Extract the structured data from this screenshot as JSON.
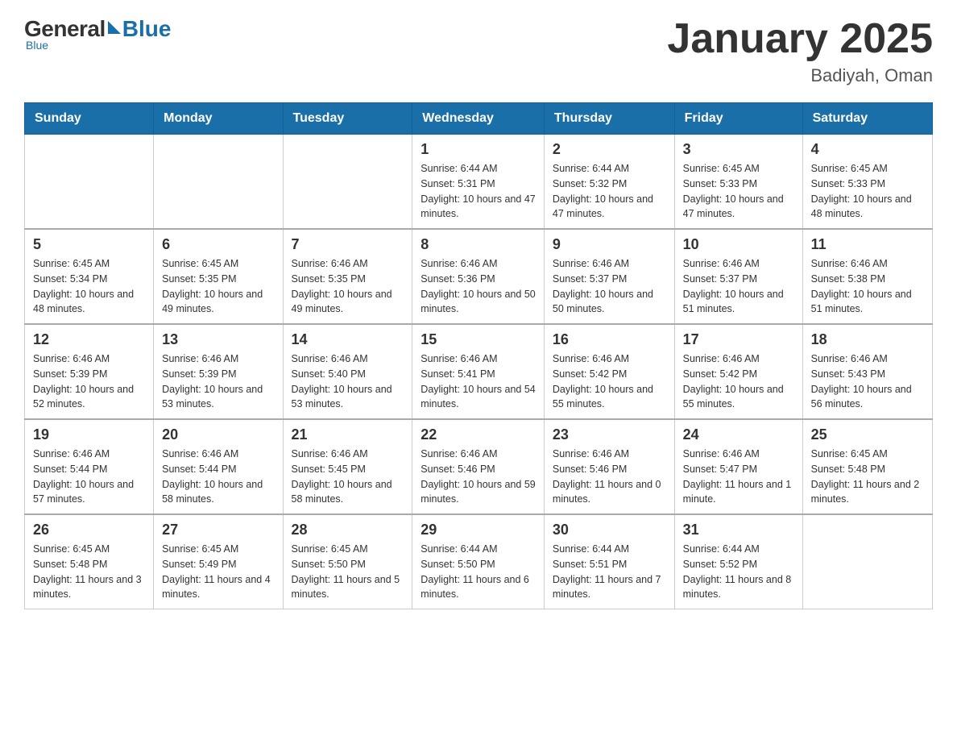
{
  "header": {
    "logo": {
      "general": "General",
      "blue": "Blue"
    },
    "title": "January 2025",
    "location": "Badiyah, Oman"
  },
  "days_of_week": [
    "Sunday",
    "Monday",
    "Tuesday",
    "Wednesday",
    "Thursday",
    "Friday",
    "Saturday"
  ],
  "weeks": [
    [
      {
        "day": "",
        "info": ""
      },
      {
        "day": "",
        "info": ""
      },
      {
        "day": "",
        "info": ""
      },
      {
        "day": "1",
        "sunrise": "6:44 AM",
        "sunset": "5:31 PM",
        "daylight": "10 hours and 47 minutes."
      },
      {
        "day": "2",
        "sunrise": "6:44 AM",
        "sunset": "5:32 PM",
        "daylight": "10 hours and 47 minutes."
      },
      {
        "day": "3",
        "sunrise": "6:45 AM",
        "sunset": "5:33 PM",
        "daylight": "10 hours and 47 minutes."
      },
      {
        "day": "4",
        "sunrise": "6:45 AM",
        "sunset": "5:33 PM",
        "daylight": "10 hours and 48 minutes."
      }
    ],
    [
      {
        "day": "5",
        "sunrise": "6:45 AM",
        "sunset": "5:34 PM",
        "daylight": "10 hours and 48 minutes."
      },
      {
        "day": "6",
        "sunrise": "6:45 AM",
        "sunset": "5:35 PM",
        "daylight": "10 hours and 49 minutes."
      },
      {
        "day": "7",
        "sunrise": "6:46 AM",
        "sunset": "5:35 PM",
        "daylight": "10 hours and 49 minutes."
      },
      {
        "day": "8",
        "sunrise": "6:46 AM",
        "sunset": "5:36 PM",
        "daylight": "10 hours and 50 minutes."
      },
      {
        "day": "9",
        "sunrise": "6:46 AM",
        "sunset": "5:37 PM",
        "daylight": "10 hours and 50 minutes."
      },
      {
        "day": "10",
        "sunrise": "6:46 AM",
        "sunset": "5:37 PM",
        "daylight": "10 hours and 51 minutes."
      },
      {
        "day": "11",
        "sunrise": "6:46 AM",
        "sunset": "5:38 PM",
        "daylight": "10 hours and 51 minutes."
      }
    ],
    [
      {
        "day": "12",
        "sunrise": "6:46 AM",
        "sunset": "5:39 PM",
        "daylight": "10 hours and 52 minutes."
      },
      {
        "day": "13",
        "sunrise": "6:46 AM",
        "sunset": "5:39 PM",
        "daylight": "10 hours and 53 minutes."
      },
      {
        "day": "14",
        "sunrise": "6:46 AM",
        "sunset": "5:40 PM",
        "daylight": "10 hours and 53 minutes."
      },
      {
        "day": "15",
        "sunrise": "6:46 AM",
        "sunset": "5:41 PM",
        "daylight": "10 hours and 54 minutes."
      },
      {
        "day": "16",
        "sunrise": "6:46 AM",
        "sunset": "5:42 PM",
        "daylight": "10 hours and 55 minutes."
      },
      {
        "day": "17",
        "sunrise": "6:46 AM",
        "sunset": "5:42 PM",
        "daylight": "10 hours and 55 minutes."
      },
      {
        "day": "18",
        "sunrise": "6:46 AM",
        "sunset": "5:43 PM",
        "daylight": "10 hours and 56 minutes."
      }
    ],
    [
      {
        "day": "19",
        "sunrise": "6:46 AM",
        "sunset": "5:44 PM",
        "daylight": "10 hours and 57 minutes."
      },
      {
        "day": "20",
        "sunrise": "6:46 AM",
        "sunset": "5:44 PM",
        "daylight": "10 hours and 58 minutes."
      },
      {
        "day": "21",
        "sunrise": "6:46 AM",
        "sunset": "5:45 PM",
        "daylight": "10 hours and 58 minutes."
      },
      {
        "day": "22",
        "sunrise": "6:46 AM",
        "sunset": "5:46 PM",
        "daylight": "10 hours and 59 minutes."
      },
      {
        "day": "23",
        "sunrise": "6:46 AM",
        "sunset": "5:46 PM",
        "daylight": "11 hours and 0 minutes."
      },
      {
        "day": "24",
        "sunrise": "6:46 AM",
        "sunset": "5:47 PM",
        "daylight": "11 hours and 1 minute."
      },
      {
        "day": "25",
        "sunrise": "6:45 AM",
        "sunset": "5:48 PM",
        "daylight": "11 hours and 2 minutes."
      }
    ],
    [
      {
        "day": "26",
        "sunrise": "6:45 AM",
        "sunset": "5:48 PM",
        "daylight": "11 hours and 3 minutes."
      },
      {
        "day": "27",
        "sunrise": "6:45 AM",
        "sunset": "5:49 PM",
        "daylight": "11 hours and 4 minutes."
      },
      {
        "day": "28",
        "sunrise": "6:45 AM",
        "sunset": "5:50 PM",
        "daylight": "11 hours and 5 minutes."
      },
      {
        "day": "29",
        "sunrise": "6:44 AM",
        "sunset": "5:50 PM",
        "daylight": "11 hours and 6 minutes."
      },
      {
        "day": "30",
        "sunrise": "6:44 AM",
        "sunset": "5:51 PM",
        "daylight": "11 hours and 7 minutes."
      },
      {
        "day": "31",
        "sunrise": "6:44 AM",
        "sunset": "5:52 PM",
        "daylight": "11 hours and 8 minutes."
      },
      {
        "day": "",
        "info": ""
      }
    ]
  ],
  "labels": {
    "sunrise": "Sunrise:",
    "sunset": "Sunset:",
    "daylight": "Daylight:"
  }
}
